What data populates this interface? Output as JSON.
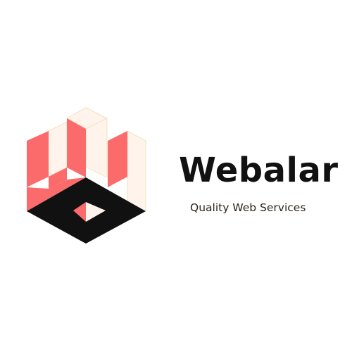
{
  "brand": {
    "name": "Webalar",
    "tagline": "Quality Web Services"
  },
  "logo": {
    "icon": "isometric-w-cube-logo-icon"
  },
  "colors": {
    "background": "#ffffff",
    "accent": "#fb6b6b",
    "dark": "#111111",
    "highlight": "#fff3ec",
    "outline": "#eee4bf",
    "tagline_text": "#2b2418"
  }
}
